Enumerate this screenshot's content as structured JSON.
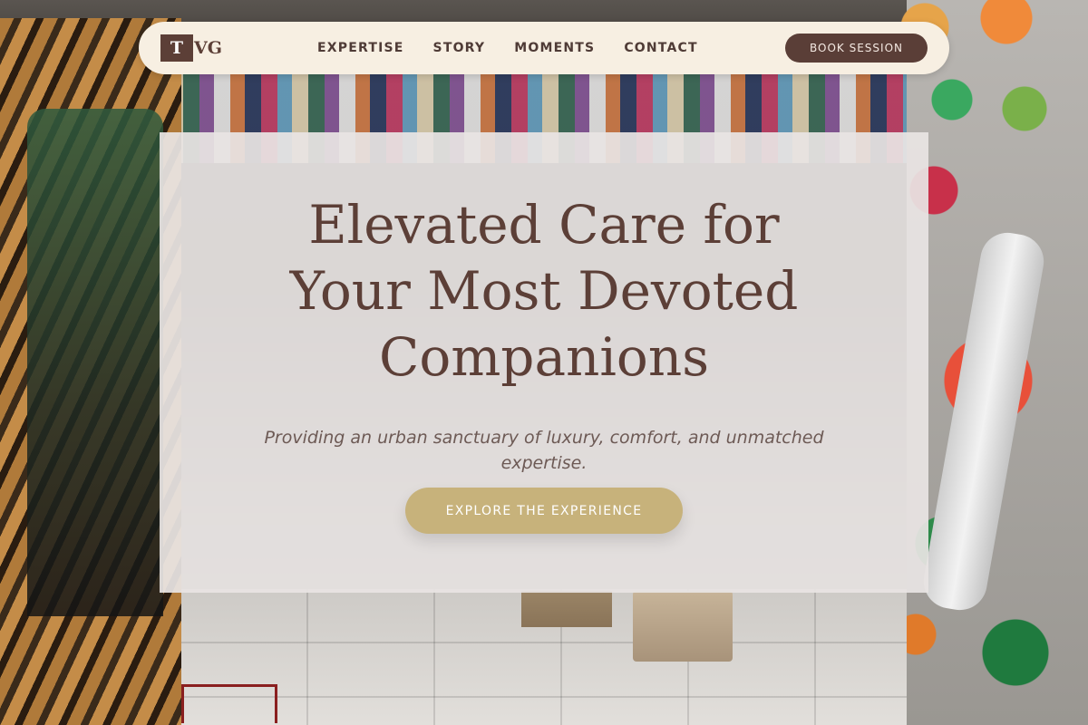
{
  "brand": {
    "logo_letter": "T",
    "logo_text": "VG"
  },
  "nav": {
    "links": [
      "EXPERTISE",
      "STORY",
      "MOMENTS",
      "CONTACT"
    ],
    "cta_label": "BOOK SESSION"
  },
  "hero": {
    "title_lines": [
      "Elevated Care for",
      "Your Most Devoted",
      "Companions"
    ],
    "subtitle": "Providing an urban sanctuary of luxury, comfort, and unmatched expertise.",
    "cta_label": "EXPLORE THE EXPERIENCE"
  },
  "colors": {
    "brand_brown": "#5c3f37",
    "nav_background": "#f7efe2",
    "cta_gold": "#c7b27b",
    "card_background": "#e8e4e3"
  }
}
